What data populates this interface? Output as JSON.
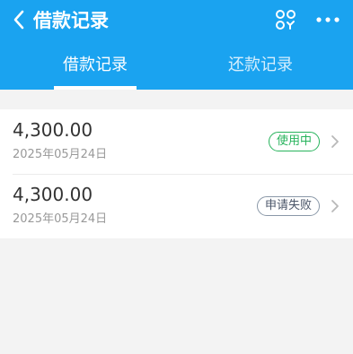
{
  "header": {
    "title": "借款记录"
  },
  "tabs": [
    {
      "label": "借款记录",
      "active": true
    },
    {
      "label": "还款记录",
      "active": false
    }
  ],
  "records": [
    {
      "amount": "4,300.00",
      "date": "2025年05月24日",
      "status": "使用中",
      "status_color": "#27b35c"
    },
    {
      "amount": "4,300.00",
      "date": "2025年05月24日",
      "status": "申请失败",
      "status_color": "#4a5568"
    }
  ],
  "colors": {
    "brand": "#1aa3f0",
    "background": "#f3f3f3"
  },
  "icons": {
    "back": "chevron-left-icon",
    "scan": "scan-code-icon",
    "more": "more-dots-icon",
    "row_arrow": "chevron-right-icon"
  }
}
